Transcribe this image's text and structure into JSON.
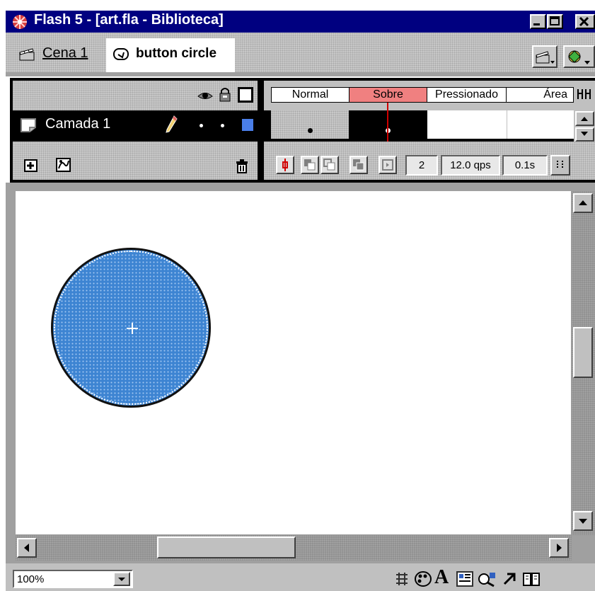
{
  "window": {
    "title": "Flash 5 - [art.fla - Biblioteca]"
  },
  "scene_bar": {
    "scene_link": "Cena 1",
    "symbol_name": "button circle"
  },
  "timeline": {
    "frame_tabs": [
      "Normal",
      "Sobre",
      "Pressionado",
      "Área"
    ],
    "active_tab": "Sobre",
    "layer": {
      "name": "Camada 1"
    },
    "current_frame": "2",
    "frame_rate": "12.0 qps",
    "elapsed_time": "0.1s"
  },
  "status_bar": {
    "zoom": "100%"
  },
  "colors": {
    "title_bar": "#000080",
    "fill": "#3d84d2",
    "active_tab": "#f08080",
    "layer_color": "#4a7ee8"
  }
}
